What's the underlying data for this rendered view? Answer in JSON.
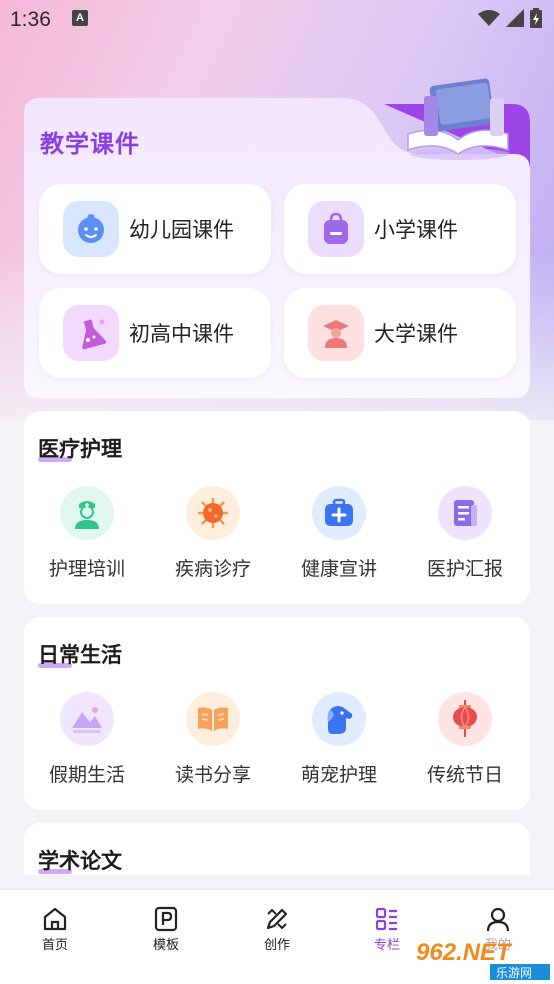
{
  "status_bar": {
    "time": "1:36",
    "notif": "A"
  },
  "teach": {
    "title": "教学课件",
    "items": [
      {
        "label": "幼儿园课件",
        "icon": "baby-face-icon",
        "bg": "#d9e6ff",
        "fg": "#5b8ff5"
      },
      {
        "label": "小学课件",
        "icon": "school-bag-icon",
        "bg": "#ecdcff",
        "fg": "#a06ae6"
      },
      {
        "label": "初高中课件",
        "icon": "flask-icon",
        "bg": "#f4d9ff",
        "fg": "#c25cdc"
      },
      {
        "label": "大学课件",
        "icon": "graduate-icon",
        "bg": "#ffe0e0",
        "fg": "#ef7878"
      }
    ]
  },
  "sections": [
    {
      "title": "医疗护理",
      "items": [
        {
          "label": "护理培训",
          "icon": "nurse-icon",
          "bg": "#dff7ee"
        },
        {
          "label": "疾病诊疗",
          "icon": "virus-icon",
          "bg": "#ffeede"
        },
        {
          "label": "健康宣讲",
          "icon": "medical-kit-icon",
          "bg": "#e2ecff"
        },
        {
          "label": "医护汇报",
          "icon": "report-icon",
          "bg": "#ede3ff"
        }
      ]
    },
    {
      "title": "日常生活",
      "items": [
        {
          "label": "假期生活",
          "icon": "landscape-icon",
          "bg": "#f1e6ff"
        },
        {
          "label": "读书分享",
          "icon": "open-book-icon",
          "bg": "#ffeede"
        },
        {
          "label": "萌宠护理",
          "icon": "dog-icon",
          "bg": "#e2ecff"
        },
        {
          "label": "传统节日",
          "icon": "lantern-icon",
          "bg": "#ffe4e4"
        }
      ]
    },
    {
      "title": "学术论文",
      "items": []
    }
  ],
  "nav": [
    {
      "label": "首页",
      "icon": "home-icon"
    },
    {
      "label": "模板",
      "icon": "template-icon"
    },
    {
      "label": "创作",
      "icon": "create-icon"
    },
    {
      "label": "专栏",
      "icon": "column-icon",
      "active": true
    },
    {
      "label": "我的",
      "icon": "profile-icon"
    }
  ],
  "watermark": {
    "text": "962.NET",
    "sub": "乐游网"
  },
  "colors": {
    "accent": "#8a3fe0",
    "underline": "#c59cf6"
  }
}
